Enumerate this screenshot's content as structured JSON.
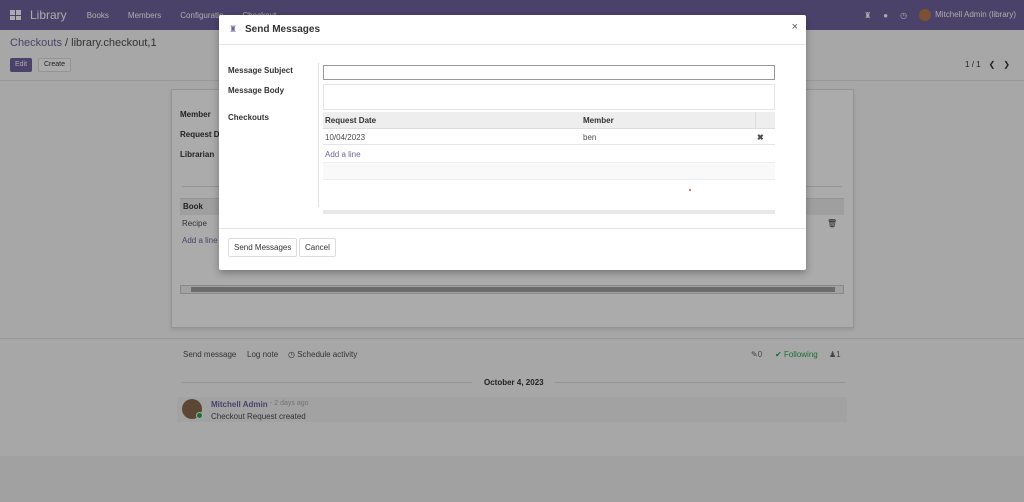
{
  "navbar": {
    "brand": "Library",
    "menu": [
      "Books",
      "Members",
      "Configuratio",
      "Checkout"
    ],
    "user": "Mitchell Admin (library)"
  },
  "control_panel": {
    "breadcrumb_parent": "Checkouts",
    "breadcrumb_current": "library.checkout,1",
    "edit_label": "Edit",
    "create_label": "Create",
    "pager": "1 / 1"
  },
  "sheet": {
    "labels": [
      "Member",
      "Request D",
      "Librarian"
    ],
    "book_header": "Book",
    "book_row": "Recipe",
    "add_line": "Add a line"
  },
  "chatter": {
    "send_message": "Send message",
    "log_note": "Log note",
    "schedule_activity": "Schedule activity",
    "attachments_count": "0",
    "following": "Following",
    "followers_count": "1",
    "date_separator": "October 4, 2023",
    "message": {
      "author": "Mitchell Admin",
      "time": "- 2 days ago",
      "body": "Checkout Request created"
    }
  },
  "modal": {
    "title": "Send Messages",
    "close": "×",
    "fields": {
      "subject_label": "Message Subject",
      "body_label": "Message Body",
      "checkouts_label": "Checkouts"
    },
    "subject_value": "",
    "table": {
      "columns": [
        "Request Date",
        "Member"
      ],
      "rows": [
        {
          "request_date": "10/04/2023",
          "member": "ben"
        }
      ],
      "add_line": "Add a line"
    },
    "buttons": {
      "send": "Send Messages",
      "cancel": "Cancel"
    }
  },
  "colors": {
    "brand": "#71639e",
    "following": "#28a745"
  }
}
